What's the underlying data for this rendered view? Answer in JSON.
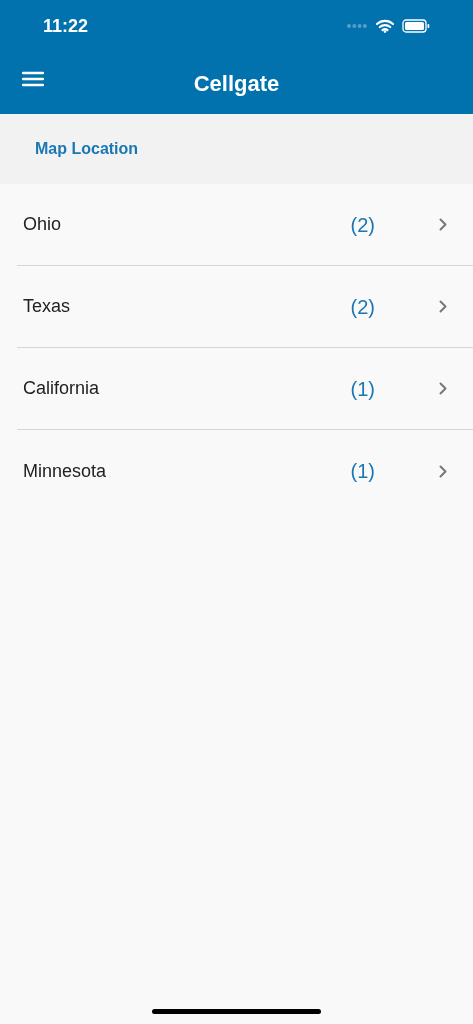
{
  "status_bar": {
    "time": "11:22"
  },
  "nav_bar": {
    "title": "Cellgate"
  },
  "section": {
    "title": "Map Location"
  },
  "locations": [
    {
      "name": "Ohio",
      "count": "(2)"
    },
    {
      "name": "Texas",
      "count": "(2)"
    },
    {
      "name": "California",
      "count": "(1)"
    },
    {
      "name": "Minnesota",
      "count": "(1)"
    }
  ]
}
